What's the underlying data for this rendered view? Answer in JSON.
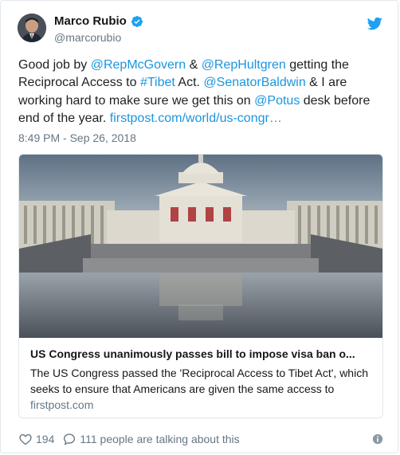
{
  "author": {
    "name": "Marco Rubio",
    "handle": "@marcorubio",
    "verified_icon": "verified-badge-icon",
    "avatar_icon": "profile-photo"
  },
  "tweet": {
    "segments": [
      {
        "text": "Good job by ",
        "link": false
      },
      {
        "text": "@RepMcGovern",
        "link": true
      },
      {
        "text": " & ",
        "link": false
      },
      {
        "text": "@RepHultgren",
        "link": true
      },
      {
        "text": " getting the Reciprocal Access to ",
        "link": false
      },
      {
        "text": "#Tibet",
        "link": true
      },
      {
        "text": " Act. ",
        "link": false
      },
      {
        "text": "@SenatorBaldwin",
        "link": true
      },
      {
        "text": " & I are working hard to make sure we get this on ",
        "link": false
      },
      {
        "text": "@Potus",
        "link": true
      },
      {
        "text": " desk before end of the year. ",
        "link": false
      },
      {
        "text": "firstpost.com/world/us-congr…",
        "link": true
      }
    ],
    "timestamp": "8:49 PM - Sep 26, 2018"
  },
  "card": {
    "title": "US Congress unanimously passes bill to impose visa ban o...",
    "description": "The US Congress passed the 'Reciprocal Access to Tibet Act', which seeks to ensure that Americans are given the same access to",
    "domain": "firstpost.com",
    "image_icon": "capitol-building-photo"
  },
  "actions": {
    "likes": "194",
    "replies_text": "111 people are talking about this"
  },
  "colors": {
    "link": "#1b95e0",
    "twitter_blue": "#1da1f2",
    "secondary_text": "#657786"
  }
}
